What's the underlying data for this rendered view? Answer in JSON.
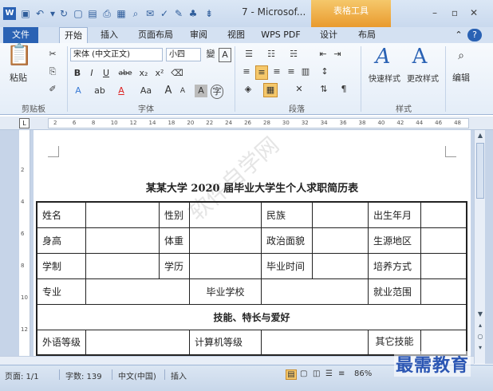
{
  "titlebar": {
    "title": "7 - Microsof...",
    "context_tab": "表格工具"
  },
  "tabs": [
    {
      "label": "文件"
    },
    {
      "label": "开始"
    },
    {
      "label": "插入"
    },
    {
      "label": "页面布局"
    },
    {
      "label": "审阅"
    },
    {
      "label": "视图"
    },
    {
      "label": "WPS PDF"
    },
    {
      "label": "设计"
    },
    {
      "label": "布局"
    }
  ],
  "ribbon": {
    "clipboard": {
      "label": "剪贴板",
      "paste": "粘贴"
    },
    "font": {
      "label": "字体",
      "font_name": "宋体 (中文正文)",
      "font_size": "小四",
      "bold": "B",
      "italic": "I",
      "underline": "U",
      "strike": "abe",
      "sub": "x₂",
      "sup": "x²",
      "grow": "A",
      "shrink": "A",
      "aa": "Aa"
    },
    "paragraph": {
      "label": "段落"
    },
    "styles": {
      "label": "样式",
      "quick": "快速样式",
      "change": "更改样式"
    },
    "editing": {
      "label": "编辑"
    }
  },
  "ruler": {
    "ticks": [
      "2",
      "6",
      "8",
      "10",
      "12",
      "14",
      "18",
      "20",
      "22",
      "24",
      "26",
      "28",
      "30",
      "32",
      "34",
      "36",
      "38",
      "40",
      "42",
      "44",
      "46",
      "48"
    ],
    "vticks": [
      "2",
      "4",
      "6",
      "8",
      "10",
      "12"
    ]
  },
  "document": {
    "title": "某某大学 2020 届毕业大学生个人求职简历表",
    "rows": [
      [
        "姓名",
        "",
        "性别",
        "",
        "民族",
        "",
        "出生年月",
        ""
      ],
      [
        "身高",
        "",
        "体重",
        "",
        "政治面貌",
        "",
        "生源地区",
        ""
      ],
      [
        "学制",
        "",
        "学历",
        "",
        "毕业时间",
        "",
        "培养方式",
        ""
      ],
      [
        "专业",
        "",
        "毕业学校",
        "",
        "就业范围",
        ""
      ]
    ],
    "section": "技能、特长与爱好",
    "lang_row": [
      "外语等级",
      "",
      "计算机等级",
      "",
      "其它技能",
      ""
    ],
    "watermark": "软件自学网"
  },
  "statusbar": {
    "page": "页面: 1/1",
    "words": "字数: 139",
    "lang": "中文(中国)",
    "mode": "插入",
    "zoom": "86%"
  },
  "brand": "最需教育",
  "colors": {
    "accent": "#2a62b4",
    "context": "#e99a2e",
    "brand": "#2b56b3"
  }
}
